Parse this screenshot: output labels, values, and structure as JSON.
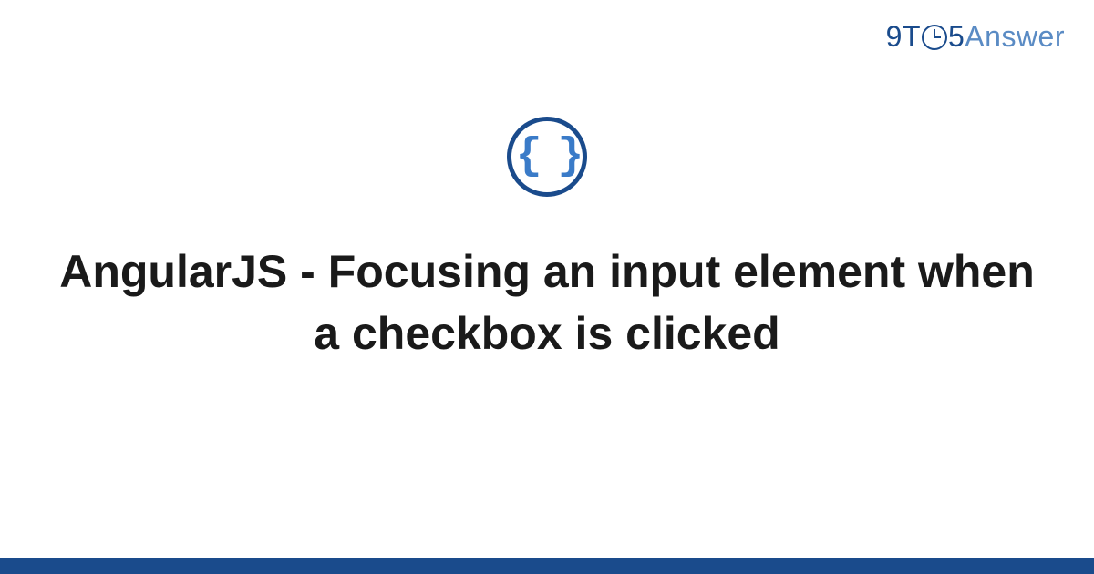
{
  "brand": {
    "part1": "9T",
    "part2": "5",
    "part3": "Answer"
  },
  "icon": {
    "name": "code-braces",
    "glyph": "{ }"
  },
  "title": "AngularJS - Focusing an input element when a checkbox is clicked",
  "colors": {
    "primary": "#1a4b8c",
    "secondary": "#5a8bc4",
    "icon_fill": "#3a7bc8"
  }
}
